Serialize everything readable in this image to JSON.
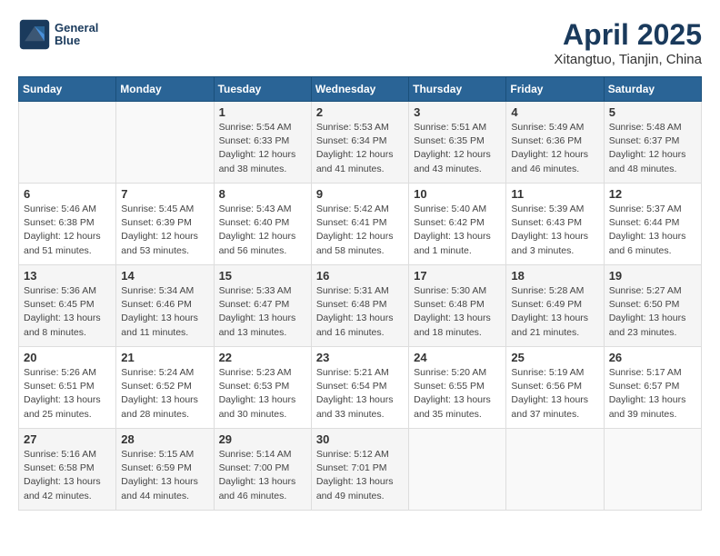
{
  "header": {
    "logo_line1": "General",
    "logo_line2": "Blue",
    "month_title": "April 2025",
    "location": "Xitangtuo, Tianjin, China"
  },
  "weekdays": [
    "Sunday",
    "Monday",
    "Tuesday",
    "Wednesday",
    "Thursday",
    "Friday",
    "Saturday"
  ],
  "weeks": [
    [
      {
        "day": null,
        "info": null
      },
      {
        "day": null,
        "info": null
      },
      {
        "day": "1",
        "info": "Sunrise: 5:54 AM\nSunset: 6:33 PM\nDaylight: 12 hours\nand 38 minutes."
      },
      {
        "day": "2",
        "info": "Sunrise: 5:53 AM\nSunset: 6:34 PM\nDaylight: 12 hours\nand 41 minutes."
      },
      {
        "day": "3",
        "info": "Sunrise: 5:51 AM\nSunset: 6:35 PM\nDaylight: 12 hours\nand 43 minutes."
      },
      {
        "day": "4",
        "info": "Sunrise: 5:49 AM\nSunset: 6:36 PM\nDaylight: 12 hours\nand 46 minutes."
      },
      {
        "day": "5",
        "info": "Sunrise: 5:48 AM\nSunset: 6:37 PM\nDaylight: 12 hours\nand 48 minutes."
      }
    ],
    [
      {
        "day": "6",
        "info": "Sunrise: 5:46 AM\nSunset: 6:38 PM\nDaylight: 12 hours\nand 51 minutes."
      },
      {
        "day": "7",
        "info": "Sunrise: 5:45 AM\nSunset: 6:39 PM\nDaylight: 12 hours\nand 53 minutes."
      },
      {
        "day": "8",
        "info": "Sunrise: 5:43 AM\nSunset: 6:40 PM\nDaylight: 12 hours\nand 56 minutes."
      },
      {
        "day": "9",
        "info": "Sunrise: 5:42 AM\nSunset: 6:41 PM\nDaylight: 12 hours\nand 58 minutes."
      },
      {
        "day": "10",
        "info": "Sunrise: 5:40 AM\nSunset: 6:42 PM\nDaylight: 13 hours\nand 1 minute."
      },
      {
        "day": "11",
        "info": "Sunrise: 5:39 AM\nSunset: 6:43 PM\nDaylight: 13 hours\nand 3 minutes."
      },
      {
        "day": "12",
        "info": "Sunrise: 5:37 AM\nSunset: 6:44 PM\nDaylight: 13 hours\nand 6 minutes."
      }
    ],
    [
      {
        "day": "13",
        "info": "Sunrise: 5:36 AM\nSunset: 6:45 PM\nDaylight: 13 hours\nand 8 minutes."
      },
      {
        "day": "14",
        "info": "Sunrise: 5:34 AM\nSunset: 6:46 PM\nDaylight: 13 hours\nand 11 minutes."
      },
      {
        "day": "15",
        "info": "Sunrise: 5:33 AM\nSunset: 6:47 PM\nDaylight: 13 hours\nand 13 minutes."
      },
      {
        "day": "16",
        "info": "Sunrise: 5:31 AM\nSunset: 6:48 PM\nDaylight: 13 hours\nand 16 minutes."
      },
      {
        "day": "17",
        "info": "Sunrise: 5:30 AM\nSunset: 6:48 PM\nDaylight: 13 hours\nand 18 minutes."
      },
      {
        "day": "18",
        "info": "Sunrise: 5:28 AM\nSunset: 6:49 PM\nDaylight: 13 hours\nand 21 minutes."
      },
      {
        "day": "19",
        "info": "Sunrise: 5:27 AM\nSunset: 6:50 PM\nDaylight: 13 hours\nand 23 minutes."
      }
    ],
    [
      {
        "day": "20",
        "info": "Sunrise: 5:26 AM\nSunset: 6:51 PM\nDaylight: 13 hours\nand 25 minutes."
      },
      {
        "day": "21",
        "info": "Sunrise: 5:24 AM\nSunset: 6:52 PM\nDaylight: 13 hours\nand 28 minutes."
      },
      {
        "day": "22",
        "info": "Sunrise: 5:23 AM\nSunset: 6:53 PM\nDaylight: 13 hours\nand 30 minutes."
      },
      {
        "day": "23",
        "info": "Sunrise: 5:21 AM\nSunset: 6:54 PM\nDaylight: 13 hours\nand 33 minutes."
      },
      {
        "day": "24",
        "info": "Sunrise: 5:20 AM\nSunset: 6:55 PM\nDaylight: 13 hours\nand 35 minutes."
      },
      {
        "day": "25",
        "info": "Sunrise: 5:19 AM\nSunset: 6:56 PM\nDaylight: 13 hours\nand 37 minutes."
      },
      {
        "day": "26",
        "info": "Sunrise: 5:17 AM\nSunset: 6:57 PM\nDaylight: 13 hours\nand 39 minutes."
      }
    ],
    [
      {
        "day": "27",
        "info": "Sunrise: 5:16 AM\nSunset: 6:58 PM\nDaylight: 13 hours\nand 42 minutes."
      },
      {
        "day": "28",
        "info": "Sunrise: 5:15 AM\nSunset: 6:59 PM\nDaylight: 13 hours\nand 44 minutes."
      },
      {
        "day": "29",
        "info": "Sunrise: 5:14 AM\nSunset: 7:00 PM\nDaylight: 13 hours\nand 46 minutes."
      },
      {
        "day": "30",
        "info": "Sunrise: 5:12 AM\nSunset: 7:01 PM\nDaylight: 13 hours\nand 49 minutes."
      },
      {
        "day": null,
        "info": null
      },
      {
        "day": null,
        "info": null
      },
      {
        "day": null,
        "info": null
      }
    ]
  ]
}
